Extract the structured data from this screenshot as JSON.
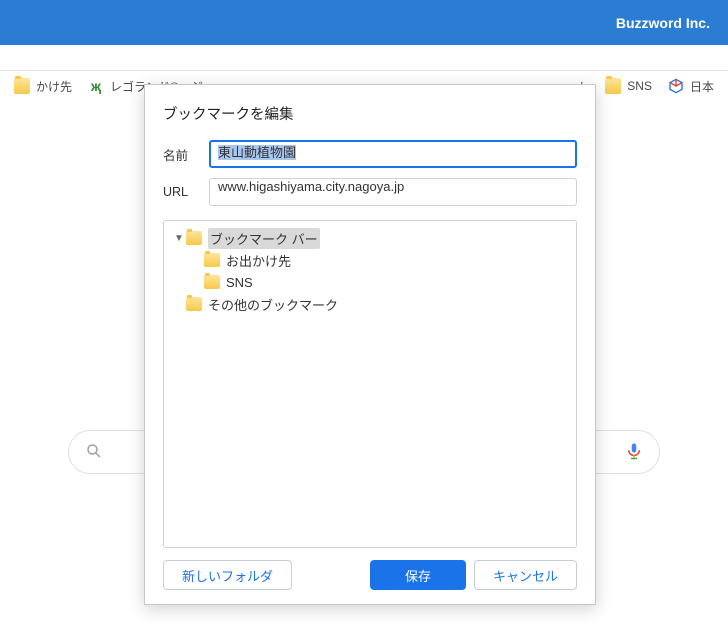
{
  "header": {
    "brand": "Buzzword Inc."
  },
  "bookmarks_bar": {
    "left": [
      {
        "label": "かけ先"
      },
      {
        "label": "レゴランド®・ジ"
      }
    ],
    "right": [
      {
        "label": "ート"
      },
      {
        "label": "SNS"
      },
      {
        "label": "日本"
      }
    ]
  },
  "dialog": {
    "title": "ブックマークを編集",
    "fields": {
      "name_label": "名前",
      "name_value": "東山動植物園",
      "url_label": "URL",
      "url_value": "www.higashiyama.city.nagoya.jp"
    },
    "tree": {
      "root": "ブックマーク バー",
      "children": [
        "お出かけ先",
        "SNS"
      ],
      "other": "その他のブックマーク"
    },
    "buttons": {
      "new_folder": "新しいフォルダ",
      "save": "保存",
      "cancel": "キャンセル"
    }
  }
}
